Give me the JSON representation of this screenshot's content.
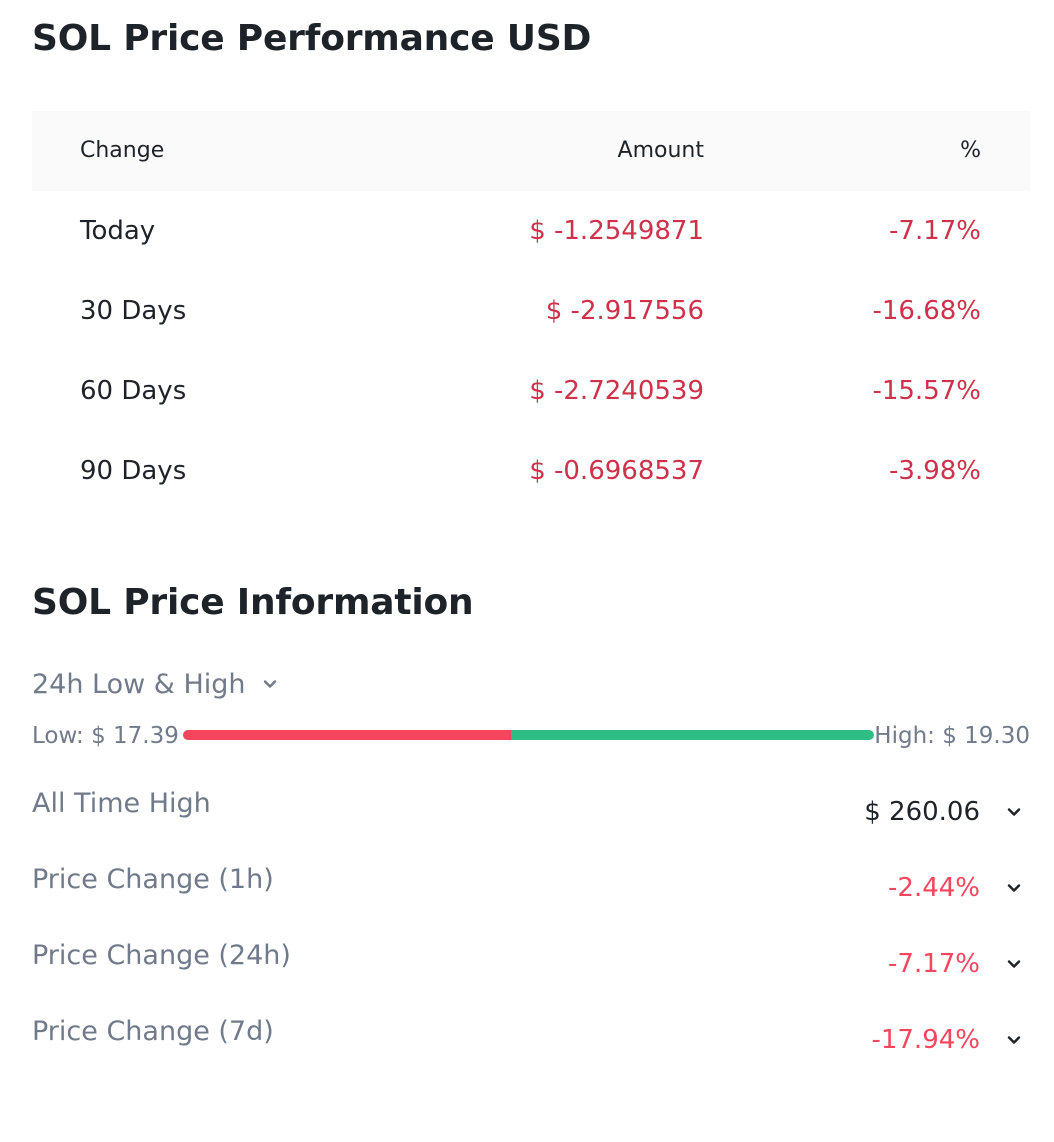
{
  "performance": {
    "title": "SOL Price Performance USD",
    "headers": {
      "change": "Change",
      "amount": "Amount",
      "percent": "%"
    },
    "rows": [
      {
        "period": "Today",
        "amount": "$ -1.2549871",
        "percent": "-7.17%"
      },
      {
        "period": "30 Days",
        "amount": "$ -2.917556",
        "percent": "-16.68%"
      },
      {
        "period": "60 Days",
        "amount": "$ -2.7240539",
        "percent": "-15.57%"
      },
      {
        "period": "90 Days",
        "amount": "$ -0.6968537",
        "percent": "-3.98%"
      }
    ]
  },
  "info": {
    "title": "SOL Price Information",
    "range_selector": "24h Low & High",
    "low": "Low: $ 17.39",
    "high": "High: $ 19.30",
    "range_position": 0.475,
    "rows": [
      {
        "label": "All Time High",
        "value": "$ 260.06",
        "tone": "neutral"
      },
      {
        "label": "Price Change (1h)",
        "value": "-2.44%",
        "tone": "neg"
      },
      {
        "label": "Price Change (24h)",
        "value": "-7.17%",
        "tone": "neg"
      },
      {
        "label": "Price Change (7d)",
        "value": "-17.94%",
        "tone": "neg"
      }
    ]
  },
  "colors": {
    "negative": "#cf304a",
    "negative_light": "#f6465d",
    "positive": "#2ebd85",
    "muted": "#707a8a",
    "text": "#1e2329",
    "header_bg": "#fafafa"
  },
  "icons": {
    "dropdown": "chevron-down-icon"
  }
}
